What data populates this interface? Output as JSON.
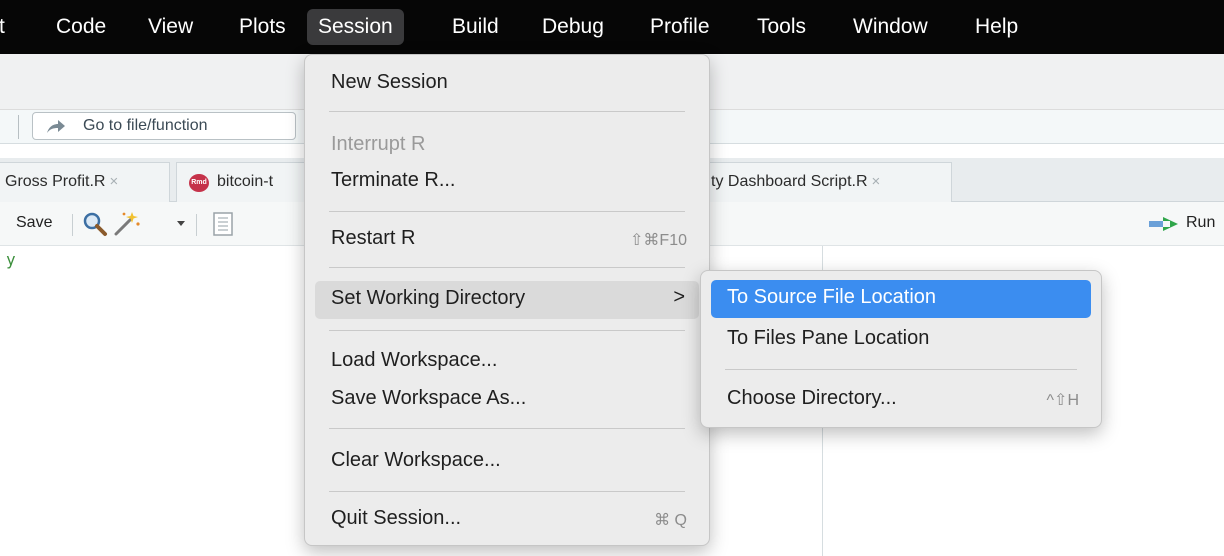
{
  "menubar": {
    "items": [
      "t",
      "Code",
      "View",
      "Plots",
      "Session",
      "Build",
      "Debug",
      "Profile",
      "Tools",
      "Window",
      "Help"
    ],
    "active": "Session"
  },
  "goto": {
    "placeholder": "Go to file/function"
  },
  "tabs": [
    {
      "label": "Gross Profit.R",
      "close": "×"
    },
    {
      "label": "bitcoin-t",
      "icon_text": "Rmd"
    },
    {
      "label": "ty Dashboard Script.R",
      "close": "×"
    }
  ],
  "editor_toolbar": {
    "save_label": "Save",
    "run_label": "Run"
  },
  "editor": {
    "visible_text": "y"
  },
  "session_menu": {
    "items": [
      {
        "label": "New Session"
      },
      {
        "label": "Interrupt R",
        "disabled": true
      },
      {
        "label": "Terminate R..."
      },
      {
        "label": "Restart R",
        "shortcut": "⇧⌘F10"
      },
      {
        "label": "Set Working Directory",
        "submenu": true,
        "arrow": ">"
      },
      {
        "label": "Load Workspace..."
      },
      {
        "label": "Save Workspace As..."
      },
      {
        "label": "Clear Workspace..."
      },
      {
        "label": "Quit Session...",
        "shortcut": "⌘ Q"
      }
    ]
  },
  "wd_submenu": {
    "items": [
      {
        "label": "To Source File Location",
        "selected": true
      },
      {
        "label": "To Files Pane Location"
      },
      {
        "label": "Choose Directory...",
        "shortcut": "^⇧H"
      }
    ]
  },
  "colors": {
    "menubar_bg": "#060606",
    "selection_blue": "#3b8df0",
    "menu_bg": "#ececec"
  }
}
